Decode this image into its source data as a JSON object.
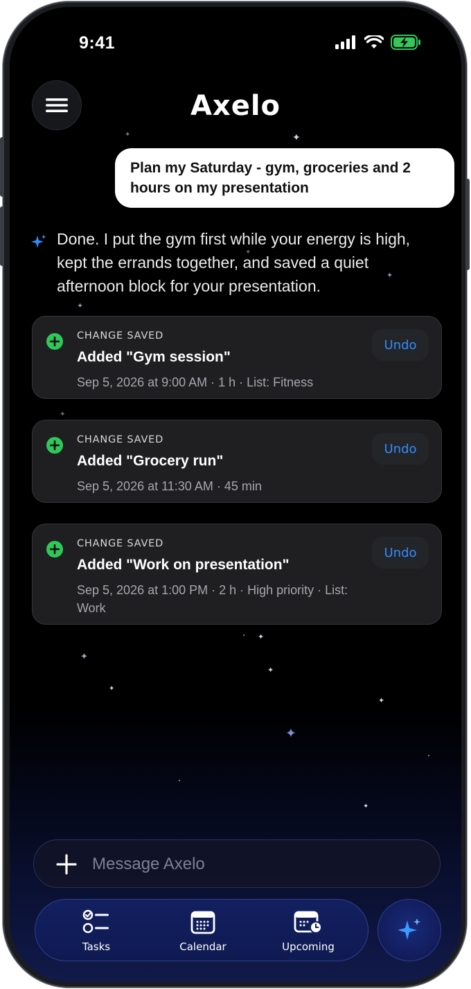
{
  "status_bar": {
    "time": "9:41"
  },
  "header": {
    "title": "Axelo"
  },
  "conversation": {
    "user_message": "Plan my Saturday - gym, groceries and 2 hours on my presentation",
    "assistant_message": "Done. I put the gym first while your energy is high, kept the errands together, and saved a quiet afternoon block for your presentation."
  },
  "changes": [
    {
      "label": "CHANGE SAVED",
      "title": "Added \"Gym session\"",
      "meta": "Sep 5, 2026 at 9:00 AM · 1 h · List: Fitness",
      "undo": "Undo"
    },
    {
      "label": "CHANGE SAVED",
      "title": "Added \"Grocery run\"",
      "meta": "Sep 5, 2026 at 11:30 AM · 45 min",
      "undo": "Undo"
    },
    {
      "label": "CHANGE SAVED",
      "title": "Added \"Work on presentation\"",
      "meta": "Sep 5, 2026 at 1:00 PM · 2 h · High priority · List: Work",
      "undo": "Undo"
    }
  ],
  "composer": {
    "placeholder": "Message Axelo"
  },
  "tabs": [
    {
      "label": "Tasks",
      "icon": "tasks-icon"
    },
    {
      "label": "Calendar",
      "icon": "calendar-icon"
    },
    {
      "label": "Upcoming",
      "icon": "upcoming-icon"
    }
  ],
  "colors": {
    "accent": "#2f8cff",
    "success": "#2fc85a",
    "card": "#1f1f21",
    "tabbar": "#132060"
  }
}
